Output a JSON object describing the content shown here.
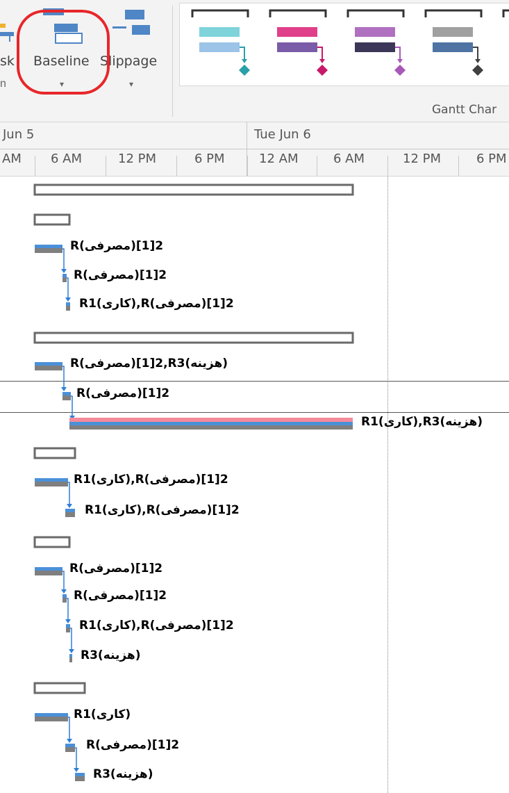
{
  "ribbon": {
    "partial_label": "sk",
    "partial_caret": "n",
    "baseline_label": "Baseline",
    "slippage_label": "Slippage",
    "group_label": "Gantt Char",
    "styles": [
      {
        "name": "teal",
        "top": "#7fd3da",
        "bottom": "#9cc3e8",
        "arrow": "#2aa0a8"
      },
      {
        "name": "pink",
        "top": "#e0408a",
        "bottom": "#7b5ca8",
        "arrow": "#c8186a"
      },
      {
        "name": "purple",
        "top": "#b070c0",
        "bottom": "#3c3658",
        "arrow": "#a858b8"
      },
      {
        "name": "gray",
        "top": "#a0a0a0",
        "bottom": "#4f74a4",
        "arrow": "#404040"
      }
    ]
  },
  "timescale": {
    "day1": "Jun 5",
    "day2": "Tue Jun 6",
    "hours": [
      "AM",
      "6 AM",
      "12 PM",
      "6 PM",
      "12 AM",
      "6 AM",
      "12 PM",
      "6 PM"
    ]
  },
  "tasks": [
    {
      "type": "summary"
    },
    {
      "type": "summary"
    },
    {
      "type": "task",
      "label": "R(مصرفی)2[1]"
    },
    {
      "type": "task",
      "label": "R(مصرفی)2[1]"
    },
    {
      "type": "task",
      "label": "R1(کاری),R(مصرفی)2[1]"
    },
    {
      "type": "summary"
    },
    {
      "type": "task",
      "label": "R(مصرفی)2[1],R3(هزینه)"
    },
    {
      "type": "task",
      "label": "R(مصرفی)2[1]"
    },
    {
      "type": "task",
      "label": "R1(کاری),R3(هزینه)"
    },
    {
      "type": "summary"
    },
    {
      "type": "task",
      "label": "R1(کاری),R(مصرفی)2[1]"
    },
    {
      "type": "task",
      "label": "R1(کاری),R(مصرفی)2[1]"
    },
    {
      "type": "summary"
    },
    {
      "type": "task",
      "label": "R(مصرفی)2[1]"
    },
    {
      "type": "task",
      "label": "R(مصرفی)2[1]"
    },
    {
      "type": "task",
      "label": "R1(کاری),R(مصرفی)2[1]"
    },
    {
      "type": "task",
      "label": "R3(هزینه)"
    },
    {
      "type": "summary"
    },
    {
      "type": "task",
      "label": "R1(کاری)"
    },
    {
      "type": "task",
      "label": "R(مصرفی)2[1]"
    },
    {
      "type": "task",
      "label": "R3(هزینه)"
    }
  ],
  "colors": {
    "task_blue": "#4a90d9",
    "baseline_gray": "#7f7f7f",
    "slippage_pink": "#f48a9a",
    "link_blue": "#2f7fd8",
    "annotation": "#e8262a"
  }
}
